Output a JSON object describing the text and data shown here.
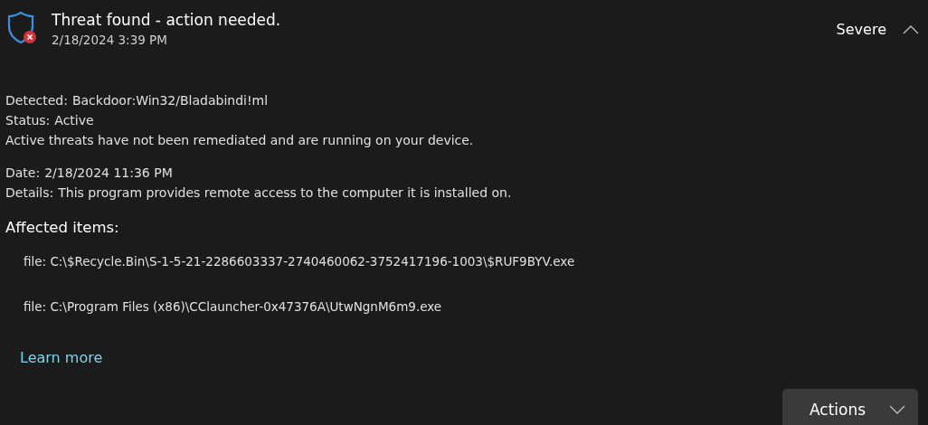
{
  "header": {
    "title": "Threat found - action needed.",
    "timestamp": "2/18/2024 3:39 PM",
    "severity": "Severe",
    "expanded": true
  },
  "summary": [
    {
      "label": "Detected:",
      "value": "Backdoor:Win32/Bladabindi!ml"
    },
    {
      "label": "Status:",
      "value": "Active"
    }
  ],
  "summary_note": "Active threats have not been remediated and are running on your device.",
  "details": [
    {
      "label": "Date:",
      "value": "2/18/2024 11:36 PM"
    },
    {
      "label": "Details:",
      "value": "This program provides remote access to the computer it is installed on."
    }
  ],
  "affected_items": {
    "heading": "Affected items:",
    "items": [
      "file: C:\\$Recycle.Bin\\S-1-5-21-2286603337-2740460062-3752417196-1003\\$RUF9BYV.exe",
      "file: C:\\Program Files (x86)\\CClauncher-0x47376A\\UtwNgnM6m9.exe"
    ]
  },
  "learn_more": "Learn more",
  "actions_button": "Actions"
}
